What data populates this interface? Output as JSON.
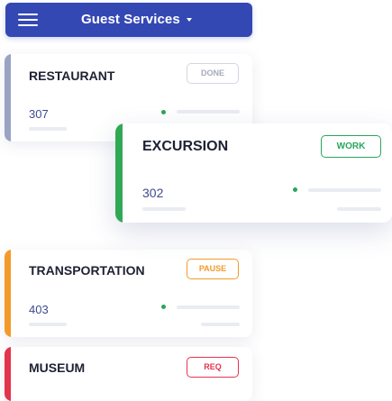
{
  "header": {
    "menu_icon": "hamburger-menu-icon",
    "title": "Guest Services",
    "dropdown_icon": "caret-down-icon",
    "color": "#3448b4"
  },
  "cards": [
    {
      "title": "RESTAURANT",
      "number": "307",
      "status": "DONE",
      "accent": "#9aa3c3"
    },
    {
      "title": "EXCURSION",
      "number": "302",
      "status": "WORK",
      "accent": "#32a856"
    },
    {
      "title": "TRANSPORTATION",
      "number": "403",
      "status": "PAUSE",
      "accent": "#f39a2b"
    },
    {
      "title": "MUSEUM",
      "status": "REQ",
      "accent": "#e3344d"
    }
  ]
}
